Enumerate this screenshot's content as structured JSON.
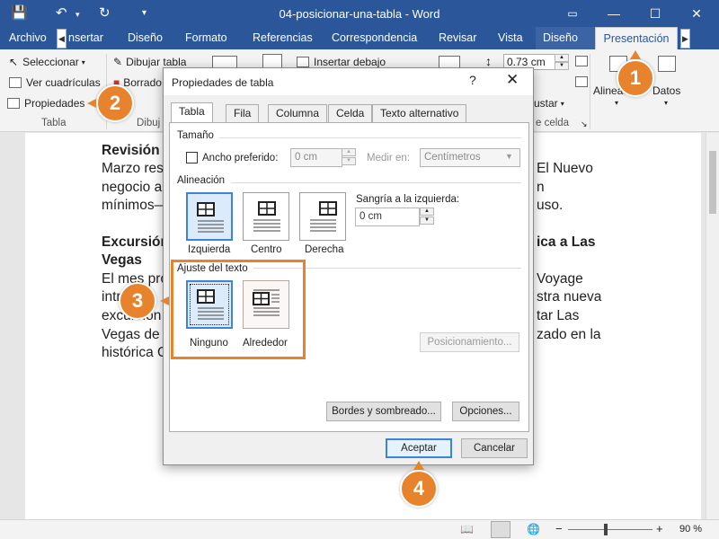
{
  "window": {
    "title": "04-posicionar-una-tabla - Word",
    "buttons": [
      "minimize",
      "maximize",
      "close"
    ]
  },
  "ribbon_tabs": [
    "Archivo",
    "nsertar",
    "Diseño",
    "Formato",
    "Referencias",
    "Correspondencia",
    "Revisar",
    "Vista",
    "Diseño",
    "Presentación"
  ],
  "ribbon": {
    "seleccionar": "Seleccionar",
    "ver_cuadriculas": "Ver cuadrículas",
    "propiedades": "Propiedades",
    "grupo_tabla": "Tabla",
    "dibujar_tabla": "Dibujar tabla",
    "borrador": "Borrado",
    "grupo_dibujar": "Dibuj",
    "insertar_debajo": "Insertar debajo",
    "height_value": "0.73 cm",
    "ajustar": "ustar",
    "grupo_celda": "e celda",
    "alineacion": "Alineaci",
    "datos": "Datos"
  },
  "document": {
    "lines": [
      "Revisión d",
      "Marzo res",
      "negocio a",
      "mínimos—",
      "Excursión",
      "Vegas",
      "El mes pró",
      "intr",
      "excursión",
      "Vegas de a",
      "histórica C"
    ],
    "right_fragments": [
      "El Nuevo",
      "n",
      "uso.",
      "ica a Las",
      "Voyage",
      "stra nueva",
      "tar Las",
      "zado en la"
    ]
  },
  "dialog": {
    "title": "Propiedades de tabla",
    "help": "?",
    "close": "✕",
    "tabs": [
      "Tabla",
      "Fila",
      "Columna",
      "Celda",
      "Texto alternativo"
    ],
    "tamano": {
      "header": "Tamaño",
      "ancho_label": "Ancho preferido:",
      "ancho_value": "0 cm",
      "medir_label": "Medir en:",
      "medir_value": "Centímetros"
    },
    "alineacion": {
      "header": "Alineación",
      "options": [
        "Izquierda",
        "Centro",
        "Derecha"
      ],
      "sangria_label": "Sangría a la izquierda:",
      "sangria_value": "0 cm"
    },
    "ajuste": {
      "header": "Ajuste del texto",
      "options": [
        "Ninguno",
        "Alrededor"
      ],
      "posicionamiento": "Posicionamiento..."
    },
    "bordes_button": "Bordes y sombreado...",
    "opciones_button": "Opciones...",
    "aceptar": "Aceptar",
    "cancelar": "Cancelar"
  },
  "callouts": [
    "1",
    "2",
    "3",
    "4"
  ],
  "status": {
    "zoom": "90 %"
  },
  "colors": {
    "word_blue": "#2b579a",
    "callout_orange": "#e8832d",
    "selection_blue": "#3b84d8"
  }
}
